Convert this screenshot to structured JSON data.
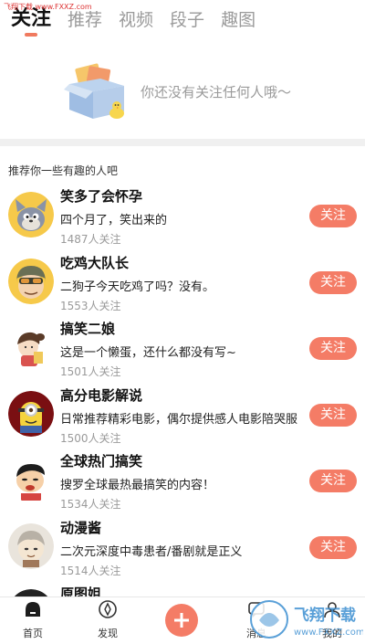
{
  "watermark": {
    "top": "飞翔下载 www.FXXZ.com",
    "bottom_brand": "飞翔下载",
    "bottom_url": "www.FXXZ.com"
  },
  "tabs": [
    {
      "label": "关注",
      "active": true
    },
    {
      "label": "推荐",
      "active": false
    },
    {
      "label": "视频",
      "active": false
    },
    {
      "label": "段子",
      "active": false
    },
    {
      "label": "趣图",
      "active": false
    }
  ],
  "empty_state": {
    "message": "你还没有关注任何人哦～"
  },
  "section_title": "推荐你一些有趣的人吧",
  "users": [
    {
      "name": "笑多了会怀孕",
      "desc": "四个月了，笑出来的",
      "count": "1487人关注",
      "follow_label": "关注",
      "avatar_icon": "cat-avatar"
    },
    {
      "name": "吃鸡大队长",
      "desc": "二狗子今天吃鸡了吗？没有。",
      "count": "1553人关注",
      "follow_label": "关注",
      "avatar_icon": "helmet-avatar"
    },
    {
      "name": "搞笑二娘",
      "desc": "这是一个懒蛋，还什么都没有写~",
      "count": "1501人关注",
      "follow_label": "关注",
      "avatar_icon": "girl-avatar"
    },
    {
      "name": "高分电影解说",
      "desc": "日常推荐精彩电影，偶尔提供感人电影陪哭服",
      "count": "1500人关注",
      "follow_label": "关注",
      "avatar_icon": "minion-avatar"
    },
    {
      "name": "全球热门搞笑",
      "desc": "搜罗全球最热最搞笑的内容！",
      "count": "1534人关注",
      "follow_label": "关注",
      "avatar_icon": "boy-avatar"
    },
    {
      "name": "动漫酱",
      "desc": "二次元深度中毒患者/番剧就是正义",
      "count": "1514人关注",
      "follow_label": "关注",
      "avatar_icon": "anime-avatar"
    },
    {
      "name": "原图姐",
      "desc": "",
      "count": "",
      "follow_label": "",
      "avatar_icon": "dark-avatar"
    }
  ],
  "bottom_nav": [
    {
      "label": "首页",
      "icon": "home-icon"
    },
    {
      "label": "发现",
      "icon": "compass-icon"
    },
    {
      "label": "",
      "icon": "plus-icon"
    },
    {
      "label": "消息",
      "icon": "message-icon"
    },
    {
      "label": "我的",
      "icon": "user-icon"
    }
  ],
  "colors": {
    "accent": "#f47c66",
    "tab_indicator": "#f07a5f",
    "muted": "#9a9a9a"
  }
}
